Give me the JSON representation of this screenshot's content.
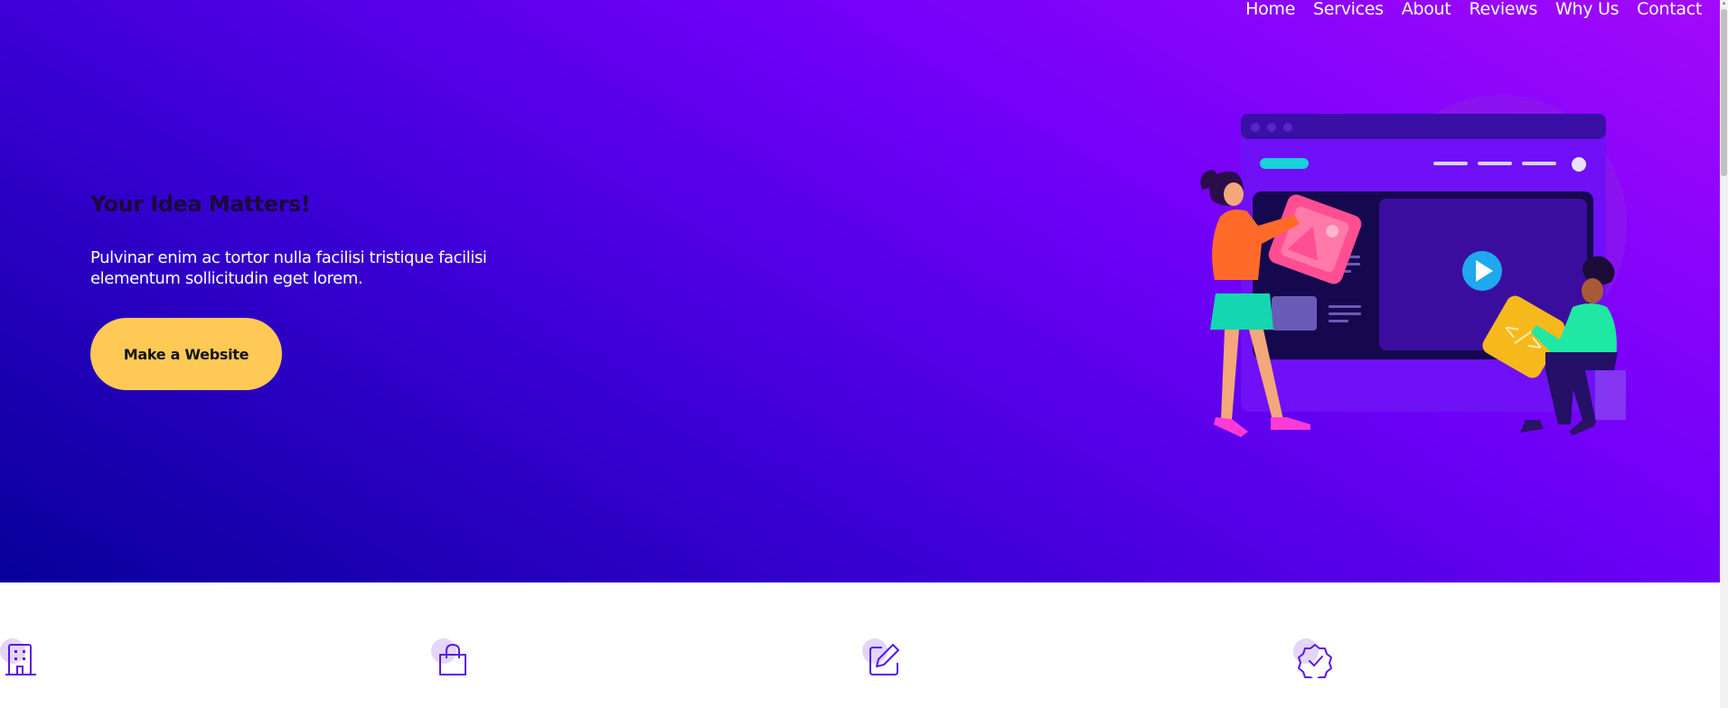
{
  "nav": {
    "items": [
      {
        "label": "Home"
      },
      {
        "label": "Services"
      },
      {
        "label": "About"
      },
      {
        "label": "Reviews"
      },
      {
        "label": "Why Us"
      },
      {
        "label": "Contact"
      }
    ]
  },
  "hero": {
    "title": "Your Idea Matters!",
    "text": "Pulvinar enim ac tortor nulla facilisi tristique facilisi elementum sollicitudin eget lorem.",
    "cta_label": "Make a Website"
  },
  "features": {
    "icons": [
      "building-icon",
      "shopping-bag-icon",
      "edit-icon",
      "verified-badge-icon"
    ]
  },
  "colors": {
    "hero_gradient_start": "#07009a",
    "hero_gradient_end": "#a309fb",
    "cta": "#ffc955",
    "icon_stroke": "#5a17e6",
    "icon_blob": "#e3d6fb"
  }
}
